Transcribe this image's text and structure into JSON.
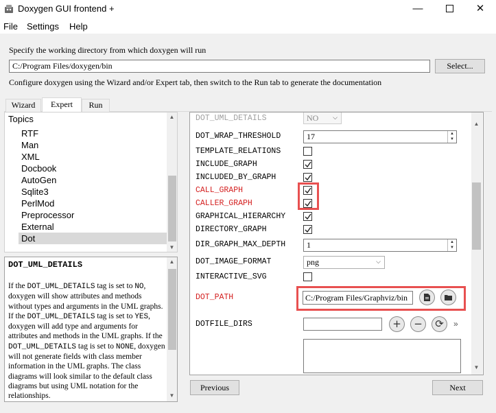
{
  "window": {
    "title": "Doxygen GUI frontend +",
    "min_glyph": "—",
    "close_glyph": "✕"
  },
  "menu": {
    "file": "File",
    "settings": "Settings",
    "help": "Help"
  },
  "workdir": {
    "label": "Specify the working directory from which doxygen will run",
    "value": "C:/Program Files/doxygen/bin",
    "select_button": "Select..."
  },
  "config_label": "Configure doxygen using the Wizard and/or Expert tab, then switch to the Run tab to generate the documentation",
  "tabs": {
    "wizard": "Wizard",
    "expert": "Expert",
    "run": "Run"
  },
  "topics": {
    "header": "Topics",
    "items": [
      "RTF",
      "Man",
      "XML",
      "Docbook",
      "AutoGen",
      "Sqlite3",
      "PerlMod",
      "Preprocessor",
      "External",
      "Dot"
    ],
    "selected": "Dot"
  },
  "help": {
    "title": "DOT_UML_DETAILS",
    "p1a": "If the ",
    "tag": "DOT_UML_DETAILS",
    "p1b": " tag is set to ",
    "no": "NO",
    "p1c": ", doxygen will show attributes and methods without types and arguments in the UML graphs.",
    "p2a": "If the ",
    "p2b": " tag is set to ",
    "yes": "YES",
    "p2c": ", doxygen will add type and arguments for attributes and methods in the UML graphs. If the ",
    "p3b": " tag is set to ",
    "none": "NONE",
    "p3c": ", doxygen will not generate fields with class member information in the UML graphs. The class diagrams will look similar to the default class diagrams but using UML notation for the relationships."
  },
  "settings": {
    "dot_uml_details": {
      "label": "DOT_UML_DETAILS",
      "value": "NO"
    },
    "dot_wrap_threshold": {
      "label": "DOT_WRAP_THRESHOLD",
      "value": "17"
    },
    "template_relations": {
      "label": "TEMPLATE_RELATIONS",
      "checked": false
    },
    "include_graph": {
      "label": "INCLUDE_GRAPH",
      "checked": true
    },
    "included_by_graph": {
      "label": "INCLUDED_BY_GRAPH",
      "checked": true
    },
    "call_graph": {
      "label": "CALL_GRAPH",
      "checked": true
    },
    "caller_graph": {
      "label": "CALLER_GRAPH",
      "checked": true
    },
    "graphical_hierarchy": {
      "label": "GRAPHICAL_HIERARCHY",
      "checked": true
    },
    "directory_graph": {
      "label": "DIRECTORY_GRAPH",
      "checked": true
    },
    "dir_graph_max_depth": {
      "label": "DIR_GRAPH_MAX_DEPTH",
      "value": "1"
    },
    "dot_image_format": {
      "label": "DOT_IMAGE_FORMAT",
      "value": "png"
    },
    "interactive_svg": {
      "label": "INTERACTIVE_SVG",
      "checked": false
    },
    "dot_path": {
      "label": "DOT_PATH",
      "value": "C:/Program Files/Graphviz/bin"
    },
    "dotfile_dirs": {
      "label": "DOTFILE_DIRS",
      "value": "",
      "more": "»"
    }
  },
  "colors": {
    "highlight_red": "#e85050",
    "label_red": "#d42020"
  },
  "icons": [
    "doxygen-app-icon",
    "file-icon",
    "folder-icon",
    "plus-icon",
    "minus-icon",
    "refresh-icon"
  ],
  "nav": {
    "previous": "Previous",
    "next": "Next"
  }
}
